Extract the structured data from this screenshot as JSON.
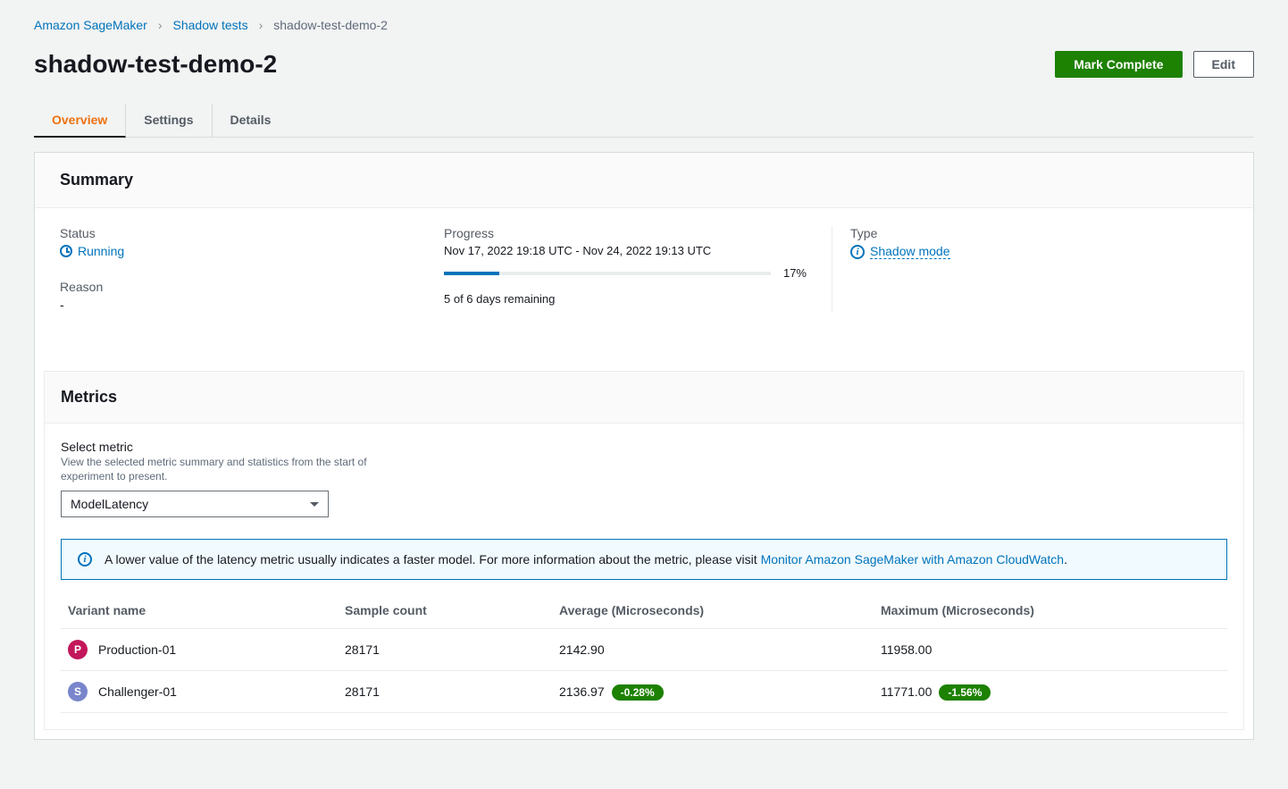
{
  "breadcrumb": {
    "root": "Amazon SageMaker",
    "shadow_tests": "Shadow tests",
    "current": "shadow-test-demo-2"
  },
  "header": {
    "title": "shadow-test-demo-2",
    "mark_complete": "Mark Complete",
    "edit": "Edit"
  },
  "tabs": {
    "overview": "Overview",
    "settings": "Settings",
    "details": "Details"
  },
  "summary": {
    "title": "Summary",
    "status_label": "Status",
    "status_value": "Running",
    "reason_label": "Reason",
    "reason_value": "-",
    "progress_label": "Progress",
    "progress_range": "Nov 17, 2022 19:18 UTC - Nov 24, 2022 19:13 UTC",
    "progress_pct": "17%",
    "progress_fill_pct": 17,
    "progress_remaining": "5 of 6 days remaining",
    "type_label": "Type",
    "type_value": "Shadow mode"
  },
  "metrics": {
    "title": "Metrics",
    "select_label": "Select metric",
    "select_help": "View the selected metric summary and statistics from the start of experiment to present.",
    "select_value": "ModelLatency",
    "info_text": "A lower value of the latency metric usually indicates a faster model. For more information about the metric, please visit ",
    "info_link": "Monitor Amazon SageMaker with Amazon CloudWatch",
    "info_period": ".",
    "columns": {
      "variant": "Variant name",
      "sample": "Sample count",
      "avg": "Average (Microseconds)",
      "max": "Maximum (Microseconds)"
    },
    "rows": [
      {
        "badge_letter": "P",
        "badge_class": "avatar-p",
        "name": "Production-01",
        "sample": "28171",
        "avg": "2142.90",
        "avg_delta": "",
        "max": "11958.00",
        "max_delta": ""
      },
      {
        "badge_letter": "S",
        "badge_class": "avatar-s",
        "name": "Challenger-01",
        "sample": "28171",
        "avg": "2136.97",
        "avg_delta": "-0.28%",
        "max": "11771.00",
        "max_delta": "-1.56%"
      }
    ]
  }
}
